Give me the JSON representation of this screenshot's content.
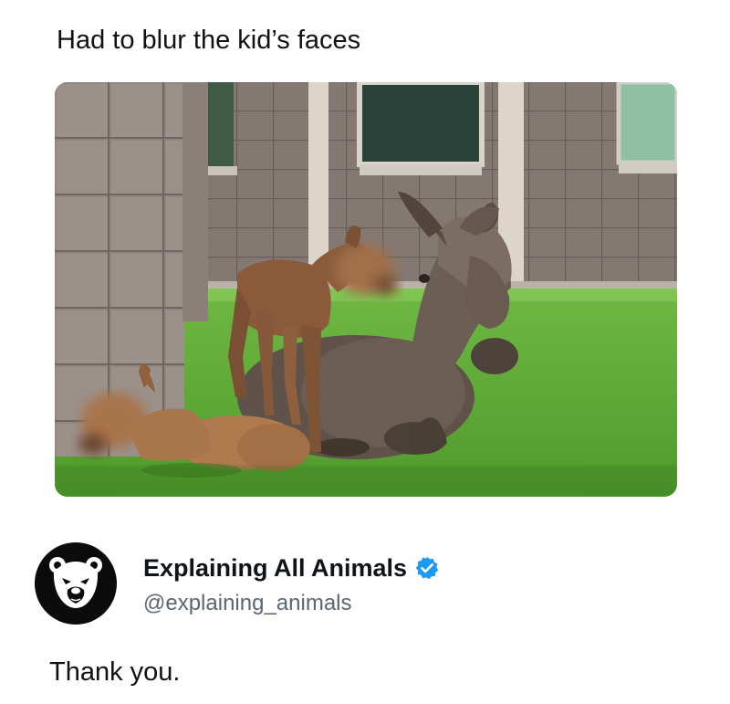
{
  "post": {
    "caption": "Had to blur the kid’s faces",
    "image_alt_subject": "moose-with-calves-photo"
  },
  "account": {
    "display_name": "Explaining All Animals",
    "handle": "@explaining_animals",
    "verified": true,
    "avatar_icon": "bear-face-icon",
    "badge_color": "#1d9bf0"
  },
  "reply": {
    "text": "Thank you."
  }
}
